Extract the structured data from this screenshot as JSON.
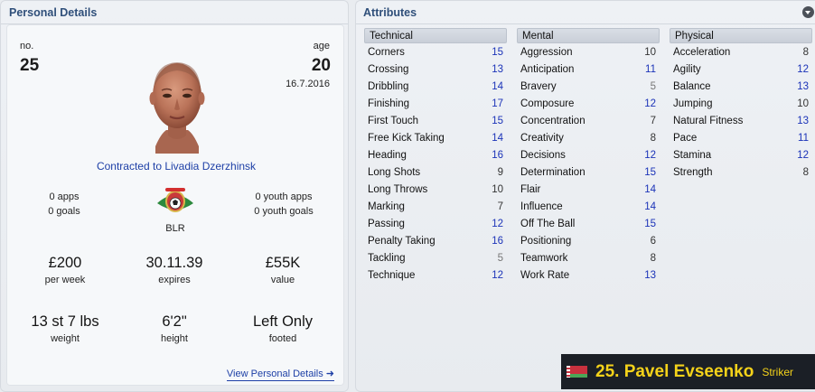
{
  "personal": {
    "title": "Personal Details",
    "no_label": "no.",
    "no_value": "25",
    "age_label": "age",
    "age_value": "20",
    "dob": "16.7.2016",
    "contract": "Contracted to Livadia Dzerzhinsk",
    "apps": "0 apps",
    "goals": "0 goals",
    "nation": "BLR",
    "youth_apps": "0 youth apps",
    "youth_goals": "0 youth goals",
    "wage": "£200",
    "wage_label": "per week",
    "expires": "30.11.39",
    "expires_label": "expires",
    "value": "£55K",
    "value_label": "value",
    "weight": "13 st 7 lbs",
    "weight_label": "weight",
    "height": "6'2\"",
    "height_label": "height",
    "foot": "Left Only",
    "foot_label": "footed",
    "link": "View Personal Details ➜"
  },
  "attributes": {
    "title": "Attributes",
    "columns": [
      {
        "name": "Technical",
        "rows": [
          {
            "label": "Corners",
            "value": "15",
            "tone": "blue"
          },
          {
            "label": "Crossing",
            "value": "13",
            "tone": "blue"
          },
          {
            "label": "Dribbling",
            "value": "14",
            "tone": "blue"
          },
          {
            "label": "Finishing",
            "value": "17",
            "tone": "blue"
          },
          {
            "label": "First Touch",
            "value": "15",
            "tone": "blue"
          },
          {
            "label": "Free Kick Taking",
            "value": "14",
            "tone": "blue"
          },
          {
            "label": "Heading",
            "value": "16",
            "tone": "blue"
          },
          {
            "label": "Long Shots",
            "value": "9",
            "tone": "dark"
          },
          {
            "label": "Long Throws",
            "value": "10",
            "tone": "dark"
          },
          {
            "label": "Marking",
            "value": "7",
            "tone": "dark"
          },
          {
            "label": "Passing",
            "value": "12",
            "tone": "blue"
          },
          {
            "label": "Penalty Taking",
            "value": "16",
            "tone": "blue"
          },
          {
            "label": "Tackling",
            "value": "5",
            "tone": "grey"
          },
          {
            "label": "Technique",
            "value": "12",
            "tone": "blue"
          }
        ]
      },
      {
        "name": "Mental",
        "rows": [
          {
            "label": "Aggression",
            "value": "10",
            "tone": "dark"
          },
          {
            "label": "Anticipation",
            "value": "11",
            "tone": "blue"
          },
          {
            "label": "Bravery",
            "value": "5",
            "tone": "grey"
          },
          {
            "label": "Composure",
            "value": "12",
            "tone": "blue"
          },
          {
            "label": "Concentration",
            "value": "7",
            "tone": "dark"
          },
          {
            "label": "Creativity",
            "value": "8",
            "tone": "dark"
          },
          {
            "label": "Decisions",
            "value": "12",
            "tone": "blue"
          },
          {
            "label": "Determination",
            "value": "15",
            "tone": "blue"
          },
          {
            "label": "Flair",
            "value": "14",
            "tone": "blue"
          },
          {
            "label": "Influence",
            "value": "14",
            "tone": "blue"
          },
          {
            "label": "Off The Ball",
            "value": "15",
            "tone": "blue"
          },
          {
            "label": "Positioning",
            "value": "6",
            "tone": "dark"
          },
          {
            "label": "Teamwork",
            "value": "8",
            "tone": "dark"
          },
          {
            "label": "Work Rate",
            "value": "13",
            "tone": "blue"
          }
        ]
      },
      {
        "name": "Physical",
        "rows": [
          {
            "label": "Acceleration",
            "value": "8",
            "tone": "dark"
          },
          {
            "label": "Agility",
            "value": "12",
            "tone": "blue"
          },
          {
            "label": "Balance",
            "value": "13",
            "tone": "blue"
          },
          {
            "label": "Jumping",
            "value": "10",
            "tone": "dark"
          },
          {
            "label": "Natural Fitness",
            "value": "13",
            "tone": "blue"
          },
          {
            "label": "Pace",
            "value": "11",
            "tone": "blue"
          },
          {
            "label": "Stamina",
            "value": "12",
            "tone": "blue"
          },
          {
            "label": "Strength",
            "value": "8",
            "tone": "dark"
          }
        ]
      }
    ]
  },
  "player_bar": {
    "name": "25. Pavel Evseenko",
    "position": "Striker"
  },
  "icons": {
    "collapse": "chevron-down-icon",
    "flag": "belarus-flag-icon",
    "badge": "football-federation-badge-icon"
  }
}
